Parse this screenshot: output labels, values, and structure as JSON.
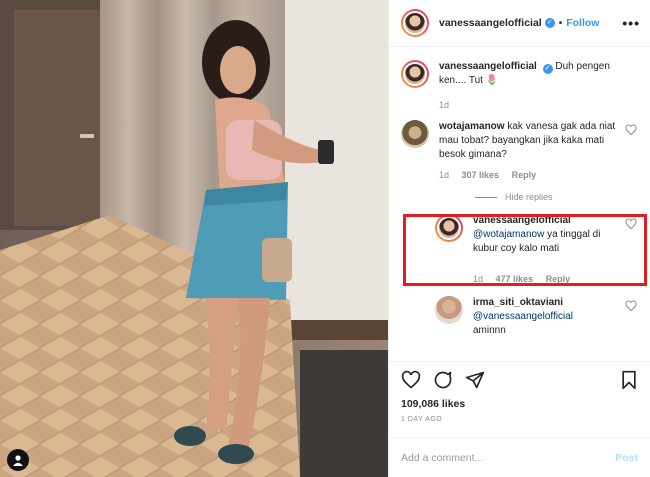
{
  "header": {
    "username": "vanessaangelofficial",
    "separator": "•",
    "follow_label": "Follow",
    "more_label": "•••"
  },
  "caption": {
    "username": "vanessaangelofficial",
    "text": "Duh pengen ken.... Tut 🌷",
    "time": "1d"
  },
  "comments": [
    {
      "username": "wotajamanow",
      "text": "kak vanesa gak ada niat mau tobat? bayangkan jika kaka mati besok gimana?",
      "time": "1d",
      "likes": "307 likes",
      "reply_label": "Reply"
    }
  ],
  "hide_replies_label": "Hide replies",
  "reply": {
    "username": "vanessaangelofficial",
    "mention": "@wotajamanow",
    "text": " ya tinggal di kubur coy kalo mati",
    "time": "1d",
    "likes": "477 likes",
    "reply_label": "Reply"
  },
  "comment3": {
    "username": "irma_siti_oktaviani",
    "mention": "@vanessaangelofficial",
    "text": "aminnn"
  },
  "post": {
    "likes": "109,086 likes",
    "ago": "1 DAY AGO"
  },
  "add_comment": {
    "placeholder": "Add a comment...",
    "post_label": "Post"
  },
  "colors": {
    "accent": "#3897f0",
    "highlight": "#e02020",
    "muted": "#8e8e8e"
  }
}
